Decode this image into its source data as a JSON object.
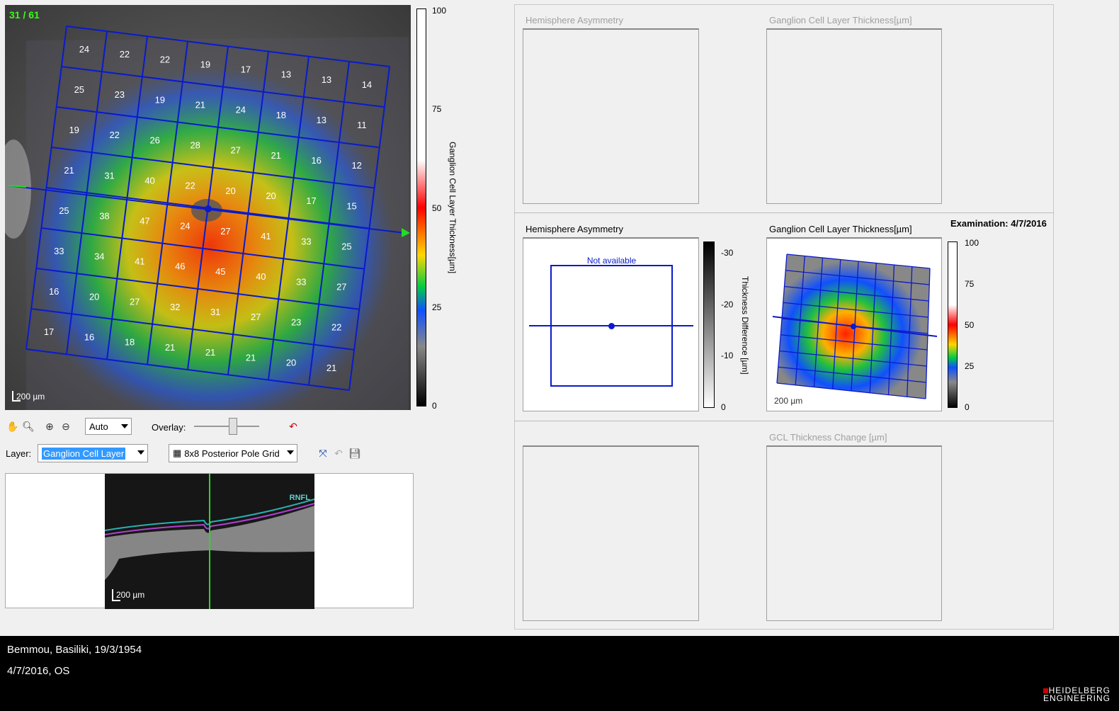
{
  "fundus": {
    "counter": "31 / 61",
    "scale": "200 µm",
    "grid_values": [
      [
        24,
        22,
        22,
        19,
        17,
        13,
        13,
        14
      ],
      [
        25,
        23,
        19,
        21,
        24,
        18,
        13,
        11
      ],
      [
        19,
        22,
        26,
        28,
        27,
        21,
        16,
        12
      ],
      [
        21,
        31,
        40,
        22,
        20,
        20,
        17,
        15
      ],
      [
        25,
        38,
        47,
        24,
        27,
        41,
        33,
        25
      ],
      [
        33,
        34,
        41,
        46,
        45,
        40,
        33,
        27
      ],
      [
        16,
        20,
        27,
        32,
        31,
        27,
        23,
        22
      ],
      [
        17,
        16,
        18,
        21,
        21,
        21,
        20,
        21
      ]
    ],
    "colorbar": {
      "label": "Ganglion Cell Layer Thickness[µm]",
      "ticks": [
        "100",
        "75",
        "50",
        "25",
        "0"
      ]
    }
  },
  "toolbar": {
    "zoom_select": "Auto",
    "overlay_label": "Overlay:",
    "overlay_level": 0.6,
    "layer_label": "Layer:",
    "layer_select": "Ganglion Cell Layer",
    "grid_select": "8x8 Posterior Pole Grid"
  },
  "bscan": {
    "scale": "200 µm",
    "layer_tag": "RNFL"
  },
  "right_top": {
    "left_title": "Hemisphere Asymmetry",
    "right_title": "Ganglion Cell Layer Thickness[µm]"
  },
  "right_mid": {
    "examination": "Examination: 4/7/2016",
    "left_title": "Hemisphere Asymmetry",
    "not_available": "Not available",
    "diff_label": "Thickness Difference [µm]",
    "diff_ticks": [
      "-30",
      "-20",
      "-10",
      "0"
    ],
    "right_title": "Ganglion Cell Layer Thickness[µm]",
    "thick_ticks": [
      "100",
      "75",
      "50",
      "25",
      "0"
    ],
    "scale": "200 µm"
  },
  "right_bottom": {
    "right_title": "GCL Thickness Change [µm]"
  },
  "footer": {
    "patient": "Bemmou, Basiliki, 19/3/1954",
    "exam": "4/7/2016, OS",
    "logo_line1": "HEIDELBERG",
    "logo_line2": "ENGINEERING"
  },
  "colors": {
    "grid_blue": "#0a1acc",
    "scan_green": "#22dd22",
    "counter_green": "#39ff14",
    "footer_bg": "#000000"
  }
}
